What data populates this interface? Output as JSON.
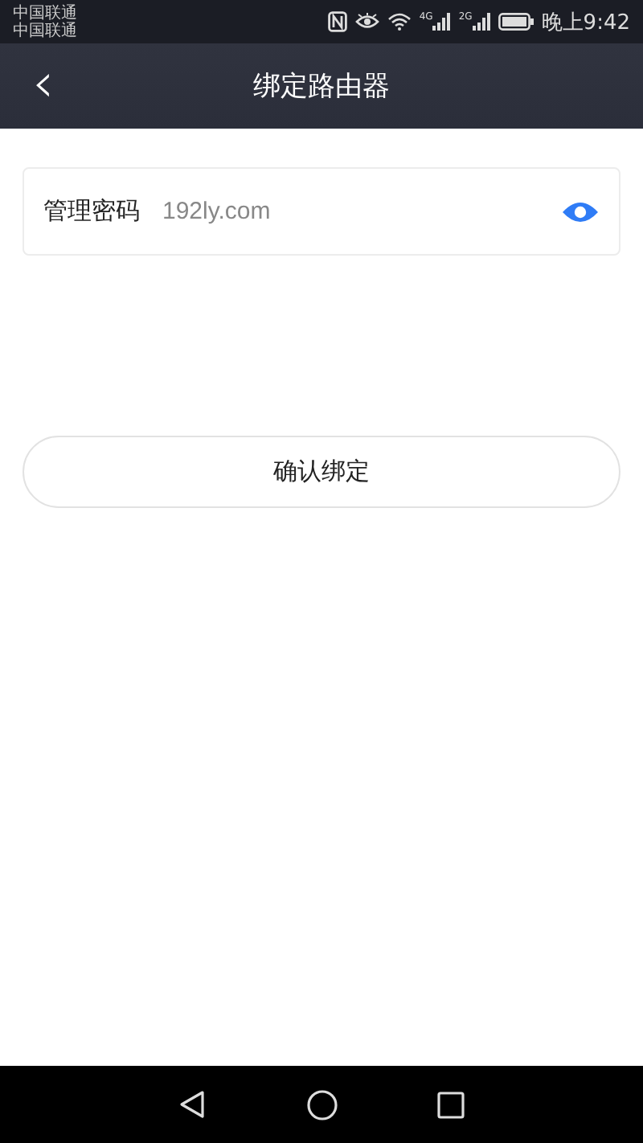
{
  "status_bar": {
    "carriers": [
      "中国联通",
      "中国联通"
    ],
    "network_labels": [
      "4G",
      "2G"
    ],
    "time": "晚上9:42"
  },
  "header": {
    "back": "‹",
    "title": "绑定路由器"
  },
  "password_field": {
    "label": "管理密码",
    "value": "192ly.com",
    "visible": true
  },
  "confirm_button": {
    "label": "确认绑定"
  }
}
